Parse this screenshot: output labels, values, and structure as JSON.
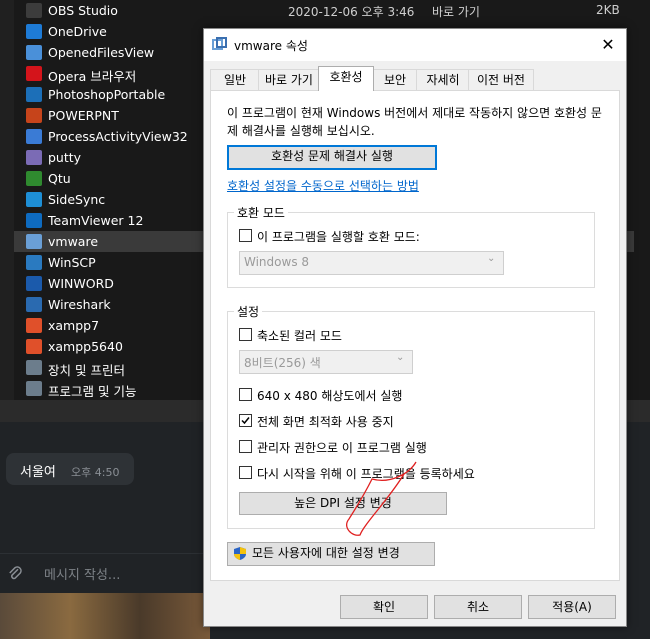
{
  "explorer": {
    "rows": [
      {
        "name": "OBS Studio",
        "date": "2020-12-06 오후 3:46",
        "type": "바로 가기",
        "size": "2KB",
        "color": "#3c3c3c"
      },
      {
        "name": "OneDrive",
        "date": "",
        "type": "",
        "size": "",
        "color": "#1e7bd6"
      },
      {
        "name": "OpenedFilesView",
        "date": "",
        "type": "",
        "size": "",
        "color": "#4a90d9"
      },
      {
        "name": "Opera 브라우저",
        "date": "",
        "type": "",
        "size": "",
        "color": "#d4141b"
      },
      {
        "name": "PhotoshopPortable",
        "date": "",
        "type": "",
        "size": "",
        "color": "#1c6fb8"
      },
      {
        "name": "POWERPNT",
        "date": "",
        "type": "",
        "size": "",
        "color": "#c6441b"
      },
      {
        "name": "ProcessActivityView32",
        "date": "",
        "type": "",
        "size": "",
        "color": "#3a7bd5"
      },
      {
        "name": "putty",
        "date": "",
        "type": "",
        "size": "",
        "color": "#7b6bb5"
      },
      {
        "name": "Qtu",
        "date": "",
        "type": "",
        "size": "",
        "color": "#2f8a2f"
      },
      {
        "name": "SideSync",
        "date": "",
        "type": "",
        "size": "",
        "color": "#1e8fd6"
      },
      {
        "name": "TeamViewer 12",
        "date": "",
        "type": "",
        "size": "",
        "color": "#0e6bc0"
      },
      {
        "name": "vmware",
        "date": "",
        "type": "",
        "size": "",
        "color": "#6a9fd6"
      },
      {
        "name": "WinSCP",
        "date": "",
        "type": "",
        "size": "",
        "color": "#2a7ac0"
      },
      {
        "name": "WINWORD",
        "date": "",
        "type": "",
        "size": "",
        "color": "#1b5aab"
      },
      {
        "name": "Wireshark",
        "date": "",
        "type": "",
        "size": "",
        "color": "#2a6ab0"
      },
      {
        "name": "xampp7",
        "date": "",
        "type": "",
        "size": "",
        "color": "#e0502a"
      },
      {
        "name": "xampp5640",
        "date": "",
        "type": "",
        "size": "",
        "color": "#e0502a"
      },
      {
        "name": "장치 및 프린터",
        "date": "",
        "type": "",
        "size": "",
        "color": "#6c7d8c"
      },
      {
        "name": "프로그램 및 기능",
        "date": "",
        "type": "",
        "size": "",
        "color": "#6c7d8c"
      }
    ]
  },
  "chat": {
    "message": "서울여",
    "time": "오후 4:50",
    "compose_placeholder": "메시지 작성..."
  },
  "dialog": {
    "title": "vmware 속성",
    "close": "✕",
    "tabs": [
      "일반",
      "바로 가기",
      "호환성",
      "보안",
      "자세히",
      "이전 버전"
    ],
    "description": "이 프로그램이 현재 Windows 버전에서 제대로 작동하지 않으면 호환성 문제 해결사를 실행해 보십시오.",
    "troubleshooter_button": "호환성 문제 해결사 실행",
    "manual_link": "호환성 설정을 수동으로 선택하는 방법",
    "compat_mode": {
      "group_label": "호환 모드",
      "checkbox_label": "이 프로그램을 실행할 호환 모드:",
      "checked": false,
      "selected_os": "Windows 8"
    },
    "settings": {
      "group_label": "설정",
      "reduced_color": {
        "label": "축소된 컬러 모드",
        "checked": false
      },
      "color_select": "8비트(256) 색",
      "res_640": {
        "label": "640 x 480 해상도에서 실행",
        "checked": false
      },
      "disable_fullscreen_opt": {
        "label": "전체 화면 최적화 사용 중지",
        "checked": true
      },
      "run_as_admin": {
        "label": "관리자 권한으로 이 프로그램 실행",
        "checked": false
      },
      "register_restart": {
        "label": "다시 시작을 위해 이 프로그램을 등록하세요",
        "checked": false
      },
      "dpi_button": "높은 DPI 설정 변경"
    },
    "all_users_button": "모든 사용자에 대한 설정 변경",
    "ok": "확인",
    "cancel": "취소",
    "apply": "적용(A)"
  }
}
